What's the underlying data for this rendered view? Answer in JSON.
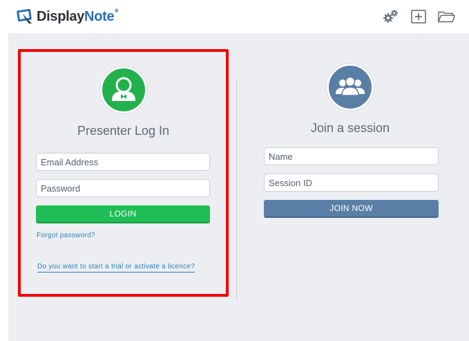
{
  "header": {
    "logo_text_display": "Display",
    "logo_text_note": "Note",
    "logo_tm": "®",
    "icons": [
      "gears-icon",
      "add-box-icon",
      "folder-icon"
    ]
  },
  "presenter": {
    "title": "Presenter Log In",
    "email_placeholder": "Email Address",
    "password_placeholder": "Password",
    "login_label": "LOGIN",
    "forgot_label": "Forgot password?",
    "trial_label": "Do you want to start a trial or activate a licence?"
  },
  "session": {
    "title": "Join a session",
    "name_placeholder": "Name",
    "session_id_placeholder": "Session ID",
    "join_label": "JOIN NOW"
  },
  "colors": {
    "green": "#1fbd55",
    "blue": "#5a7fa6",
    "highlight": "#f20000",
    "link": "#2c7fb8"
  }
}
